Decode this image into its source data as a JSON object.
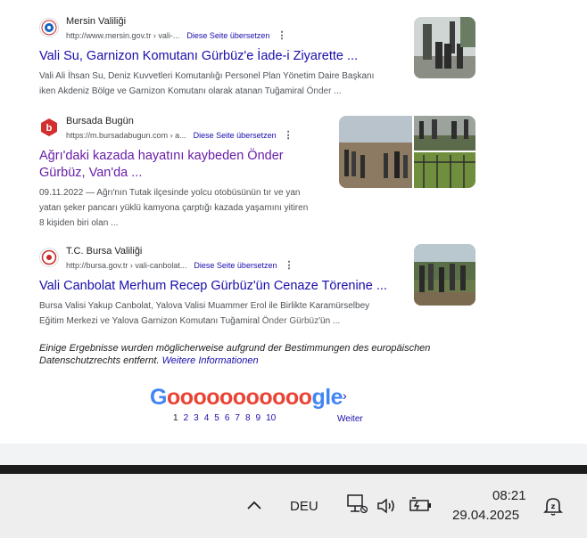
{
  "results": [
    {
      "site": "Mersin Valiliği",
      "url": "http://www.mersin.gov.tr › vali-...",
      "translate": "Diese Seite übersetzen",
      "title": "Vali Su, Garnizon Komutanı Gürbüz'e İade-i Ziyarette ...",
      "snippet_line1": "Vali Ali İhsan Su, Deniz Kuvvetleri Komutanlığı Personel Plan Yönetim Daire Başkanı",
      "snippet_line2_pre": "iken Akdeniz Bölge ve Garnizon Komutanı olarak atanan Tuğamiral ",
      "snippet_line2_hl": "Önder",
      "snippet_line2_post": " ..."
    },
    {
      "site": "Bursada Bugün",
      "url": "https://m.bursadabugun.com › a...",
      "translate": "Diese Seite übersetzen",
      "title_line1": "Ağrı'daki kazada hayatını kaybeden Önder",
      "title_line2": "Gürbüz, Van'da ...",
      "snippet_line1": "09.11.2022 — Ağrı'nın Tutak ilçesinde yolcu otobüsünün tır ve yan",
      "snippet_line2": "yatan şeker pancarı yüklü kamyona çarptığı kazada yaşamını yitiren",
      "snippet_line3": "8 kişiden biri olan ..."
    },
    {
      "site": "T.C. Bursa Valiliği",
      "url": "http://bursa.gov.tr › vali-canbolat...",
      "translate": "Diese Seite übersetzen",
      "title": "Vali Canbolat Merhum Recep Gürbüz'ün Cenaze Törenine ...",
      "snippet_line1": "Bursa Valisi Yakup Canbolat, Yalova Valisi Muammer Erol ile Birlikte Karamürselbey",
      "snippet_line2_pre": "Eğitim Merkezi ve Yalova Garnizon Komutanı Tuğamiral ",
      "snippet_line2_hl": "Önder Gürbüz",
      "snippet_line2_post": "'ün ..."
    }
  ],
  "notice": {
    "text": "Einige Ergebnisse wurden möglicherweise aufgrund der Bestimmungen des europäischen Datenschutzrechts entfernt. ",
    "link": "Weitere Informationen"
  },
  "pagination": {
    "logo_g1": "G",
    "logo_os": "ooooooooooo",
    "logo_gle": "gle",
    "pages": [
      "1",
      "2",
      "3",
      "4",
      "5",
      "6",
      "7",
      "8",
      "9",
      "10"
    ],
    "next_label": "Weiter",
    "next_icon": "chevron-right-icon"
  },
  "taskbar": {
    "language": "DEU",
    "time": "08:21",
    "date": "29.04.2025",
    "icons": [
      "chevron-up-icon",
      "network-icon",
      "speaker-icon",
      "battery-icon",
      "notification-bell-icon"
    ]
  },
  "colors": {
    "link": "#1a0dab",
    "visited": "#681da8",
    "snippet": "#4d5156"
  }
}
